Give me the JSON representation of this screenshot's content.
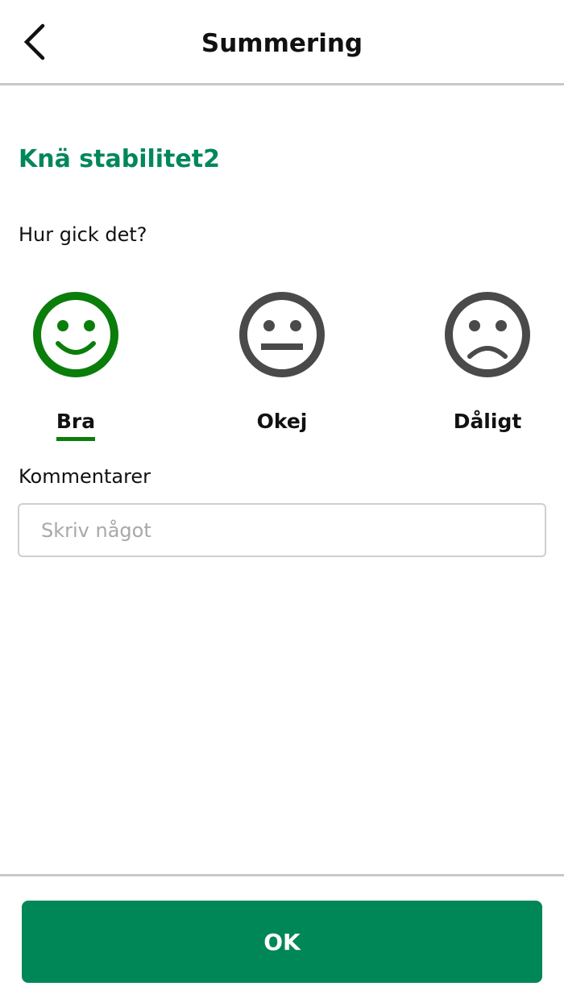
{
  "header": {
    "title": "Summering",
    "back_icon": "chevron-left-icon"
  },
  "exercise": {
    "title": "Knä stabilitet2"
  },
  "question": "Hur gick det?",
  "ratings": [
    {
      "label": "Bra",
      "icon": "smiley-happy-icon",
      "color": "#0a7d0a",
      "selected": true
    },
    {
      "label": "Okej",
      "icon": "smiley-neutral-icon",
      "color": "#4a4a4a",
      "selected": false
    },
    {
      "label": "Dåligt",
      "icon": "smiley-sad-icon",
      "color": "#4a4a4a",
      "selected": false
    }
  ],
  "comments": {
    "label": "Kommentarer",
    "placeholder": "Skriv något",
    "value": ""
  },
  "footer": {
    "ok_label": "OK"
  },
  "colors": {
    "accent": "#00875a",
    "button": "#008757",
    "selected": "#0a7d0a",
    "icon_gray": "#4a4a4a"
  }
}
